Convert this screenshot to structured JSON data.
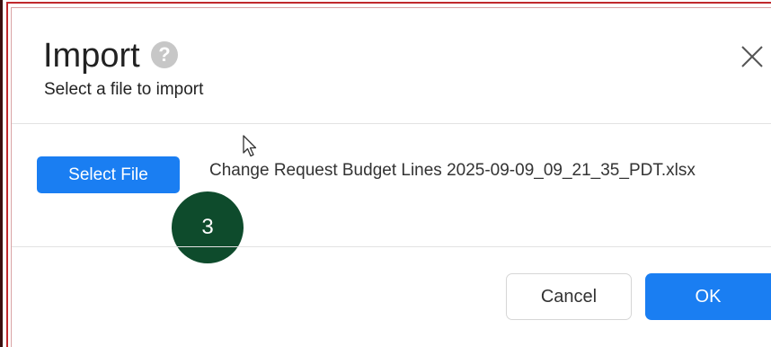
{
  "dialog": {
    "title": "Import",
    "help_icon": "question-mark-icon",
    "help_glyph": "?",
    "subtitle": "Select a file to import",
    "close_icon": "close-x-icon"
  },
  "file_picker": {
    "select_button_label": "Select File",
    "selected_file_name": "Change Request Budget Lines 2025-09-09_09_21_35_PDT.xlsx"
  },
  "annotation": {
    "step_number": "3"
  },
  "footer": {
    "cancel_label": "Cancel",
    "ok_label": "OK"
  },
  "colors": {
    "primary": "#1a7ef2",
    "badge": "#0e4b2c",
    "frame_border": "#c0282c"
  }
}
